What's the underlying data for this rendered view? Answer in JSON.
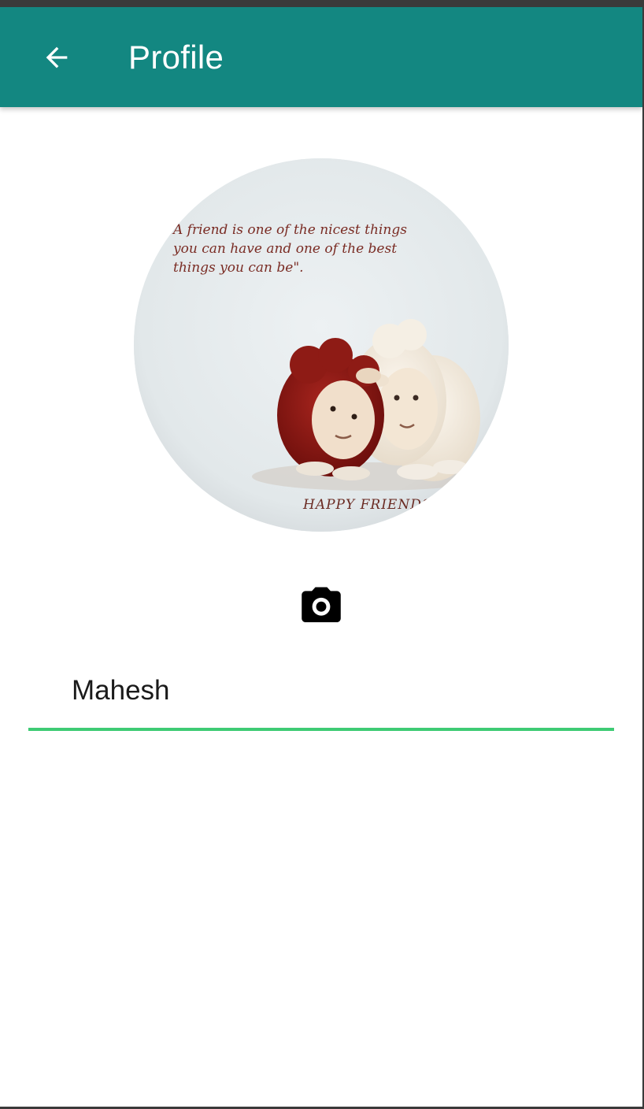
{
  "appbar": {
    "title": "Profile",
    "back_icon": "arrow-left-icon",
    "background_color": "#138781",
    "text_color": "#ffffff"
  },
  "profile": {
    "avatar": {
      "icon": "profile-photo",
      "image_text_lines": [
        "A friend is one of the nicest things",
        "you can have and one of the best",
        "things you can be\"."
      ],
      "image_caption": "HAPPY FRIENDSHIP"
    },
    "camera_icon": "camera-icon",
    "name_field": {
      "value": "Mahesh",
      "underline_color": "#3ecb74"
    }
  }
}
